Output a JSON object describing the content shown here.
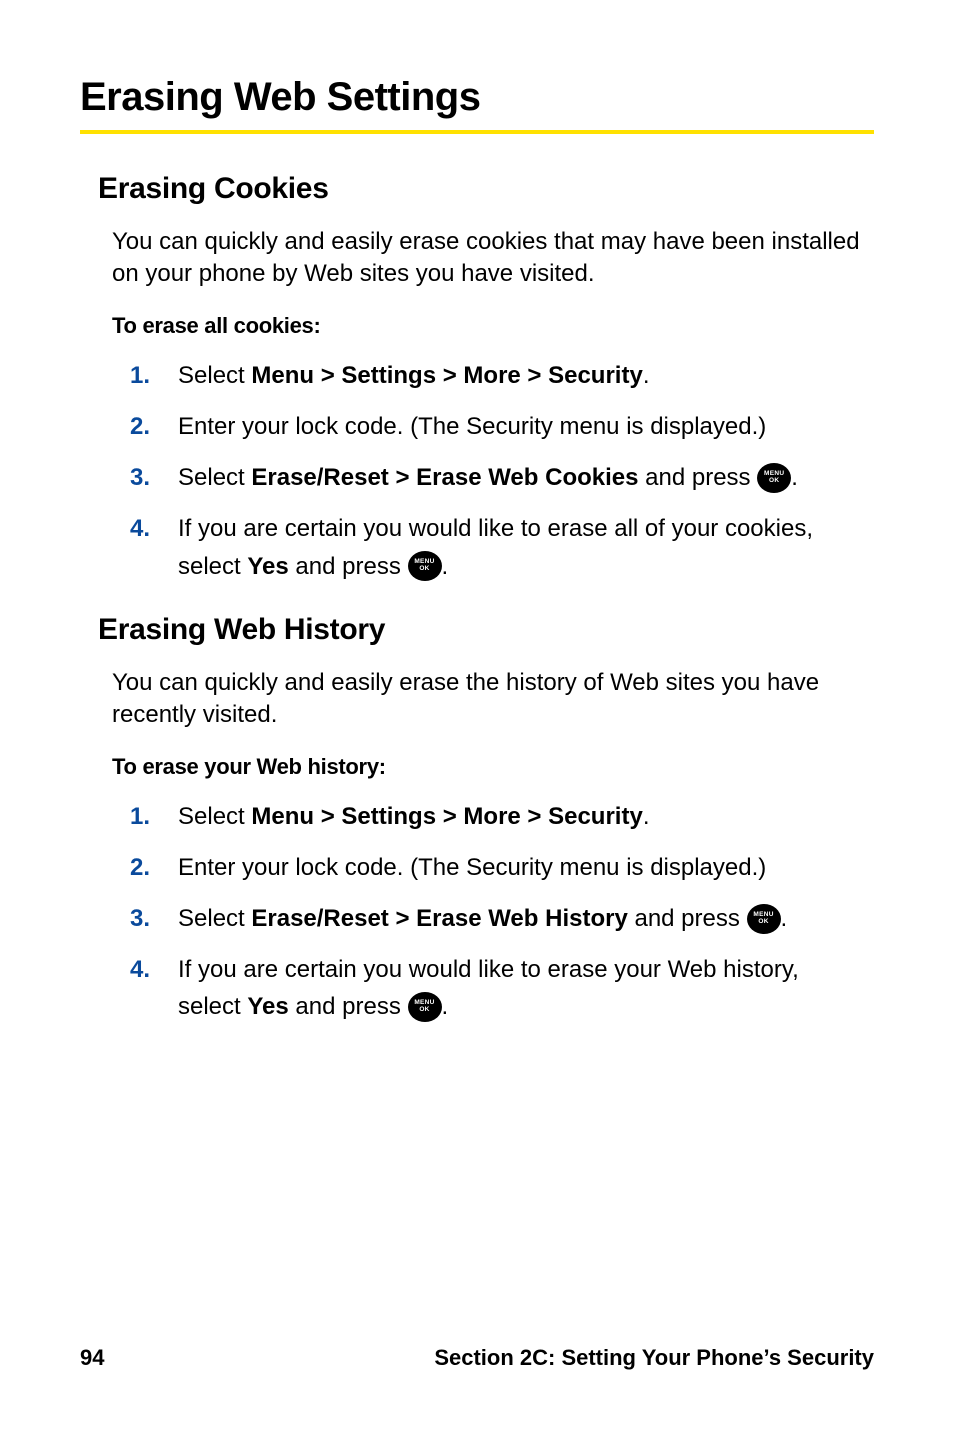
{
  "page": {
    "title": "Erasing Web Settings"
  },
  "cookies": {
    "heading": "Erasing Cookies",
    "intro": "You can quickly and easily erase cookies that may have been installed on your phone by Web sites you have visited.",
    "instruction": "To erase all cookies:",
    "steps": {
      "s1_a": "Select ",
      "s1_b": "Menu > Settings > More > Security",
      "s1_c": ".",
      "s2": "Enter your lock code. (The Security menu is displayed.)",
      "s3_a": "Select ",
      "s3_b": "Erase/Reset > Erase Web Cookies",
      "s3_c": " and press ",
      "s3_d": ".",
      "s4_a": "If you are certain you would like to erase all of your cookies, select ",
      "s4_b": "Yes",
      "s4_c": " and press ",
      "s4_d": "."
    }
  },
  "history": {
    "heading": "Erasing Web History",
    "intro": "You can quickly and easily erase the history of Web sites you have recently visited.",
    "instruction": "To erase your Web history:",
    "steps": {
      "s1_a": "Select ",
      "s1_b": "Menu > Settings > More > Security",
      "s1_c": ".",
      "s2": "Enter your lock code. (The Security menu is displayed.)",
      "s3_a": "Select ",
      "s3_b": "Erase/Reset > Erase Web History",
      "s3_c": " and press ",
      "s3_d": ".",
      "s4_a": "If you are certain you would like to erase your Web history, select ",
      "s4_b": "Yes",
      "s4_c": " and press ",
      "s4_d": "."
    }
  },
  "icon": {
    "label": "MENU\nOK"
  },
  "footer": {
    "page_number": "94",
    "section": "Section 2C: Setting Your Phone’s Security"
  }
}
